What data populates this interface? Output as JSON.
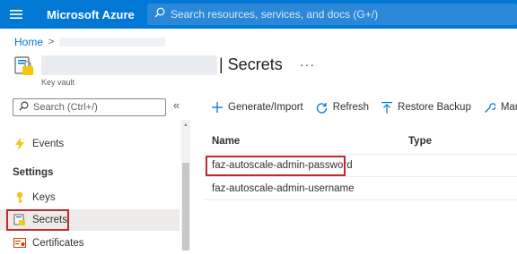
{
  "topbar": {
    "brand": "Microsoft Azure",
    "search_placeholder": "Search resources, services, and docs (G+/)"
  },
  "breadcrumb": {
    "home": "Home",
    "separator": ">"
  },
  "header": {
    "title": "| Secrets",
    "more": "···",
    "subtitle": "Key vault"
  },
  "sidebar": {
    "search_placeholder": "Search (Ctrl+/)",
    "collapse": "«",
    "items": [
      {
        "label": "Events",
        "icon": "lightning-icon"
      },
      {
        "label": "Keys",
        "icon": "key-icon"
      },
      {
        "label": "Secrets",
        "icon": "secret-icon",
        "active": true
      },
      {
        "label": "Certificates",
        "icon": "certificate-icon"
      }
    ],
    "section_heading": "Settings"
  },
  "toolbar": {
    "generate": "Generate/Import",
    "refresh": "Refresh",
    "restore": "Restore Backup",
    "manage": "Manage"
  },
  "table": {
    "columns": [
      "Name",
      "Type"
    ],
    "rows": [
      {
        "name": "faz-autoscale-admin-password",
        "type": ""
      },
      {
        "name": "faz-autoscale-admin-username",
        "type": ""
      }
    ]
  },
  "colors": {
    "brand_blue": "#0078d4",
    "highlight_red": "#c4262e"
  }
}
